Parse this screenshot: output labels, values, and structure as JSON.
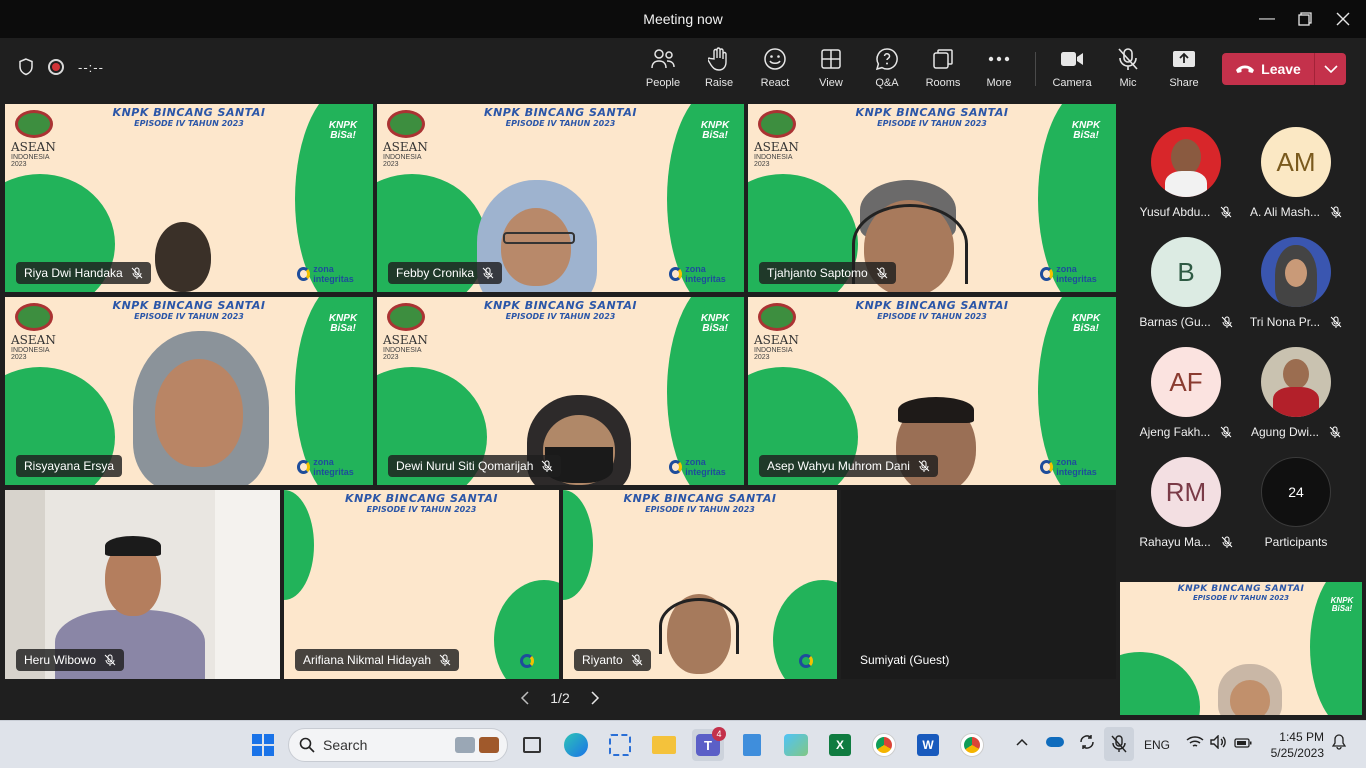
{
  "window": {
    "title": "Meeting now"
  },
  "toolbar": {
    "timer": "--:--",
    "tools": [
      {
        "id": "people",
        "label": "People"
      },
      {
        "id": "raise",
        "label": "Raise"
      },
      {
        "id": "react",
        "label": "React"
      },
      {
        "id": "view",
        "label": "View"
      },
      {
        "id": "qa",
        "label": "Q&A"
      },
      {
        "id": "rooms",
        "label": "Rooms"
      },
      {
        "id": "more",
        "label": "More"
      },
      {
        "id": "camera",
        "label": "Camera"
      },
      {
        "id": "mic",
        "label": "Mic"
      },
      {
        "id": "share",
        "label": "Share"
      }
    ],
    "leave_label": "Leave"
  },
  "banner": {
    "line1": "KNPK BINCANG SANTAI",
    "line2": "EPISODE IV TAHUN 2023",
    "asean": "ASEAN",
    "asean_sub": "INDONESIA 2023",
    "bisa": "KNPK BiSa!",
    "zona": "zona integritas"
  },
  "videos": [
    {
      "name": "Riya Dwi Handaka"
    },
    {
      "name": "Febby Cronika"
    },
    {
      "name": "Tjahjanto Saptomo"
    },
    {
      "name": "Risyayana Ersya"
    },
    {
      "name": "Dewi Nurul Siti Qomarijah"
    },
    {
      "name": "Asep Wahyu Muhrom Dani"
    },
    {
      "name": "Heru Wibowo"
    },
    {
      "name": "Arifiana Nikmal Hidayah"
    },
    {
      "name": "Riyanto"
    },
    {
      "name": "Sumiyati (Guest)"
    }
  ],
  "pager": {
    "label": "1/2"
  },
  "participants": [
    {
      "name": "Yusuf Abdu...",
      "initials": "",
      "color": "#d8262a"
    },
    {
      "name": "A. Ali Mash...",
      "initials": "AM",
      "color": "#fbe8c4"
    },
    {
      "name": "Barnas (Gu...",
      "initials": "B",
      "color": "#dcebe3"
    },
    {
      "name": "Tri Nona Pr...",
      "initials": "",
      "color": "#3a56b0"
    },
    {
      "name": "Ajeng Fakh...",
      "initials": "AF",
      "color": "#fbe3e0"
    },
    {
      "name": "Agung Dwi...",
      "initials": "",
      "color": "#c9c2b0"
    },
    {
      "name": "Rahayu Ma...",
      "initials": "RM",
      "color": "#f3dfe2"
    }
  ],
  "participants_count": {
    "count": "24",
    "label": "Participants"
  },
  "taskbar": {
    "search_placeholder": "Search",
    "teams_badge": "4",
    "language": "ENG",
    "time": "1:45 PM",
    "date": "5/25/2023"
  }
}
